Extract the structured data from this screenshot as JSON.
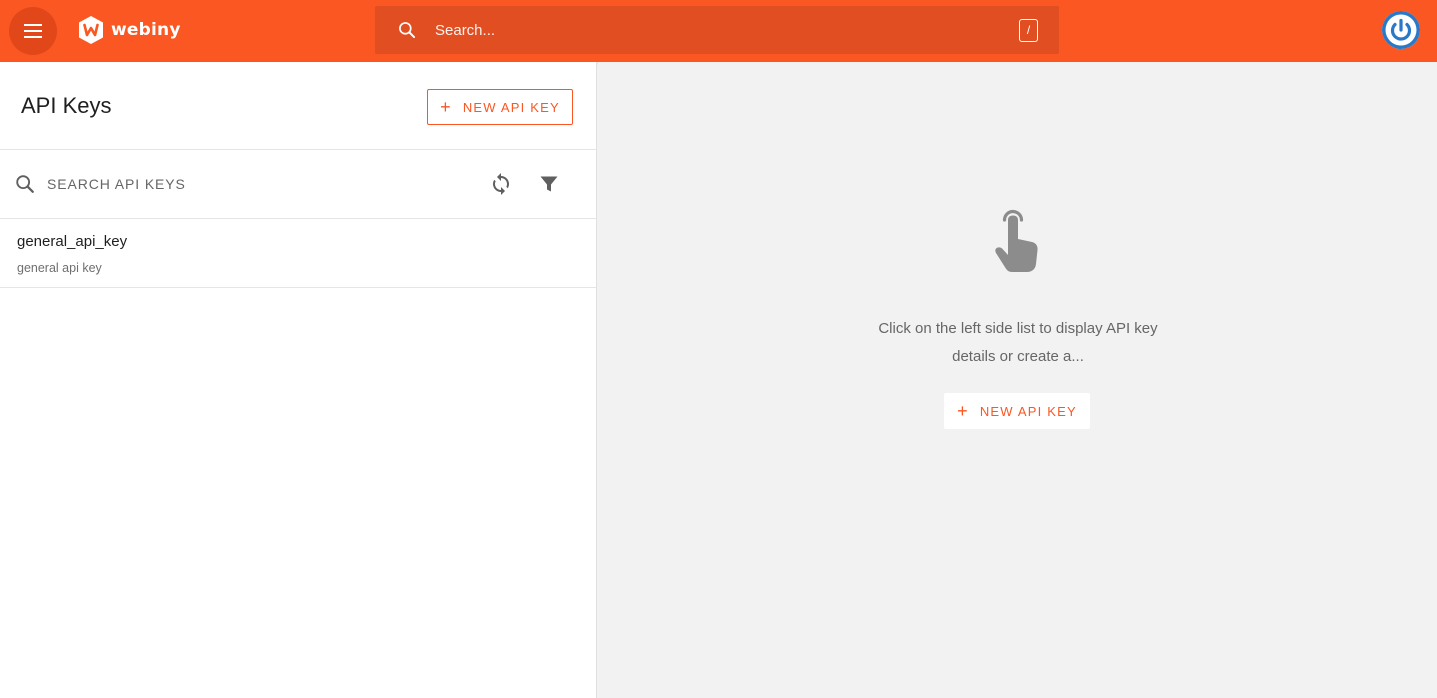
{
  "header": {
    "menu_icon": "hamburger-menu-icon",
    "logo_text": "webiny",
    "search_placeholder": "Search...",
    "search_shortcut": "/",
    "avatar_icon": "user-avatar-icon"
  },
  "list_panel": {
    "title": "API Keys",
    "new_button_label": "NEW API KEY",
    "search_placeholder": "SEARCH API KEYS",
    "refresh_icon": "refresh-icon",
    "filter_icon": "filter-icon",
    "items": [
      {
        "name": "general_api_key",
        "description": "general api key"
      }
    ]
  },
  "detail_panel": {
    "empty_icon": "touch-hand-icon",
    "empty_message": "Click on the left side list to display API key details or create a...",
    "new_button_label": "NEW API KEY"
  },
  "colors": {
    "brand": "#fa5723",
    "brand_dark": "#e04e22",
    "avatar_ring": "#2a79c8",
    "icon_gray": "#5f5f5f"
  }
}
